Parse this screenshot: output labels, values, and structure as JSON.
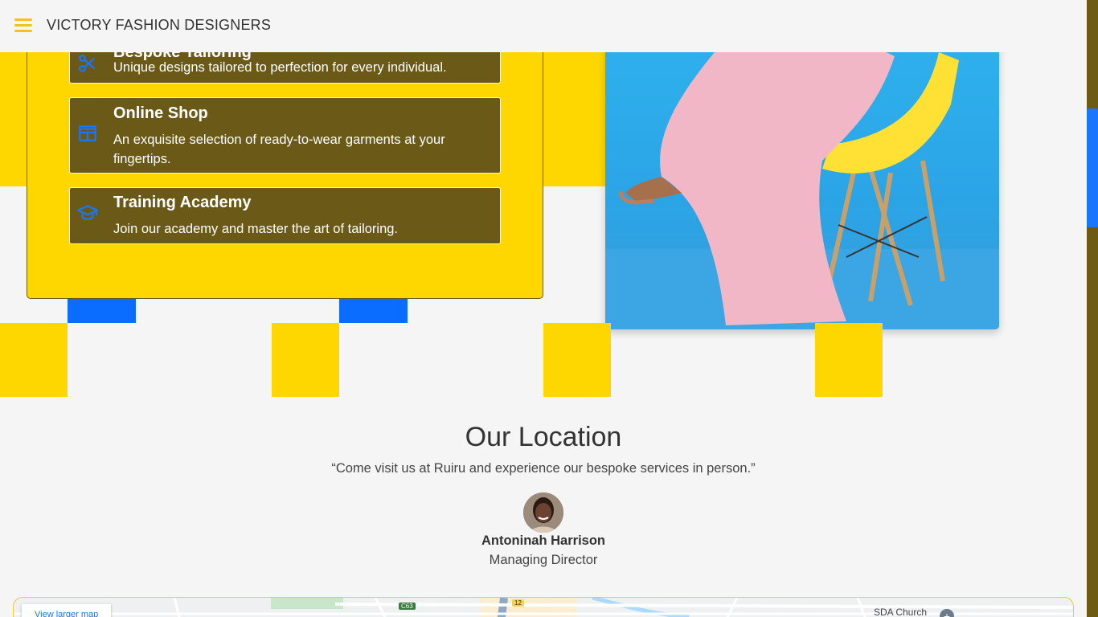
{
  "header": {
    "brand": "VICTORY FASHION DESIGNERS",
    "menu_icon": "hamburger-menu-icon",
    "accent_color": "#f5c21b"
  },
  "services": [
    {
      "icon": "scissors-icon",
      "title": "Bespoke Tailoring",
      "description": "Unique designs tailored to perfection for every individual."
    },
    {
      "icon": "storefront-icon",
      "title": "Online Shop",
      "description": "An exquisite selection of ready-to-wear garments at your fingertips."
    },
    {
      "icon": "graduation-cap-icon",
      "title": "Training Academy",
      "description": "Join our academy and master the art of tailoring."
    }
  ],
  "location": {
    "title": "Our Location",
    "quote": "“Come visit us at Ruiru and experience our bespoke services in person.”",
    "person_name": "Antoninah Harrison",
    "person_role": "Managing Director"
  },
  "map": {
    "view_larger": "View larger map",
    "road_badge_1": "C63",
    "road_badge_2": "12",
    "place_label": "SDA Church"
  },
  "colors": {
    "yellow": "#ffd700",
    "olive": "#6b5a17",
    "blue": "#0a6dff",
    "service_icon_blue": "#1a75ff"
  }
}
